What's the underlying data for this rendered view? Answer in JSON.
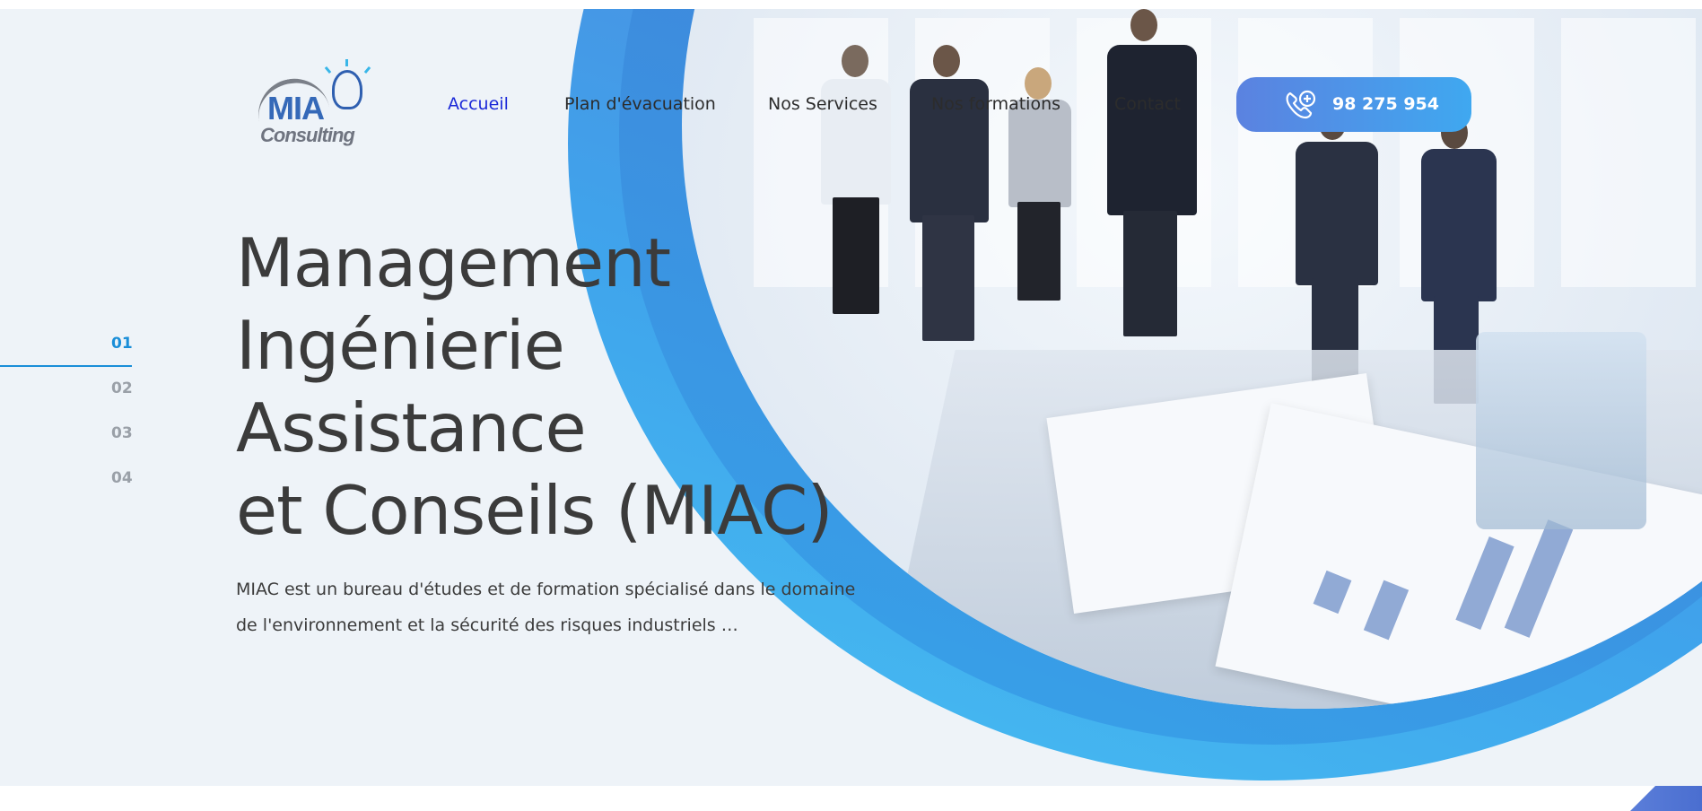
{
  "brand": {
    "logo_text": "MIA",
    "logo_sub": "Consulting"
  },
  "nav": {
    "items": [
      {
        "label": "Accueil",
        "active": true
      },
      {
        "label": "Plan d'évacuation",
        "active": false
      },
      {
        "label": "Nos Services",
        "active": false
      },
      {
        "label": "Nos formations",
        "active": false
      },
      {
        "label": "Contact",
        "active": false
      }
    ]
  },
  "contact": {
    "phone": "98 275 954",
    "icon": "phone-icon"
  },
  "slider": {
    "indicators": [
      "01",
      "02",
      "03",
      "04"
    ],
    "active_index": 0
  },
  "hero": {
    "headline_lines": [
      "Management",
      "Ingénierie",
      "Assistance",
      "et Conseils (MIAC)"
    ],
    "description_lines": [
      "MIAC est un bureau d'études et de formation spécialisé dans le domaine",
      "de l'environnement et la sécurité des risques industriels …"
    ]
  },
  "colors": {
    "accent": "#1a8ed8",
    "nav_active": "#1a28d8",
    "button_gradient_start": "#5b82e0",
    "button_gradient_end": "#3fa8f0",
    "headline": "#3b3b3b",
    "background": "#eef3f8"
  }
}
